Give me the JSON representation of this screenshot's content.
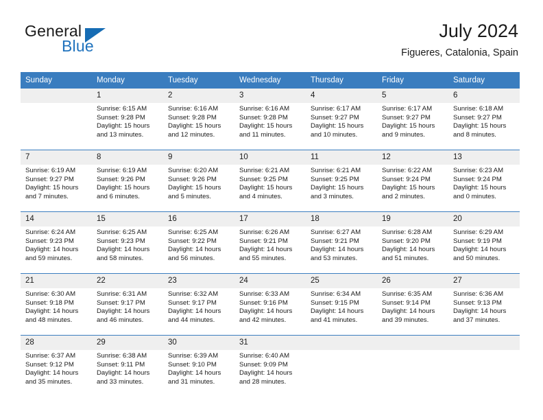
{
  "brand": {
    "name_top": "General",
    "name_bottom": "Blue"
  },
  "header": {
    "title": "July 2024",
    "subtitle": "Figueres, Catalonia, Spain"
  },
  "calendar": {
    "weekday_headers": [
      "Sunday",
      "Monday",
      "Tuesday",
      "Wednesday",
      "Thursday",
      "Friday",
      "Saturday"
    ],
    "accent_color": "#3a7dbf",
    "daynum_background": "#efefef",
    "weeks": [
      [
        {
          "day": "",
          "lines": []
        },
        {
          "day": "1",
          "lines": [
            "Sunrise: 6:15 AM",
            "Sunset: 9:28 PM",
            "Daylight: 15 hours",
            "and 13 minutes."
          ]
        },
        {
          "day": "2",
          "lines": [
            "Sunrise: 6:16 AM",
            "Sunset: 9:28 PM",
            "Daylight: 15 hours",
            "and 12 minutes."
          ]
        },
        {
          "day": "3",
          "lines": [
            "Sunrise: 6:16 AM",
            "Sunset: 9:28 PM",
            "Daylight: 15 hours",
            "and 11 minutes."
          ]
        },
        {
          "day": "4",
          "lines": [
            "Sunrise: 6:17 AM",
            "Sunset: 9:27 PM",
            "Daylight: 15 hours",
            "and 10 minutes."
          ]
        },
        {
          "day": "5",
          "lines": [
            "Sunrise: 6:17 AM",
            "Sunset: 9:27 PM",
            "Daylight: 15 hours",
            "and 9 minutes."
          ]
        },
        {
          "day": "6",
          "lines": [
            "Sunrise: 6:18 AM",
            "Sunset: 9:27 PM",
            "Daylight: 15 hours",
            "and 8 minutes."
          ]
        }
      ],
      [
        {
          "day": "7",
          "lines": [
            "Sunrise: 6:19 AM",
            "Sunset: 9:27 PM",
            "Daylight: 15 hours",
            "and 7 minutes."
          ]
        },
        {
          "day": "8",
          "lines": [
            "Sunrise: 6:19 AM",
            "Sunset: 9:26 PM",
            "Daylight: 15 hours",
            "and 6 minutes."
          ]
        },
        {
          "day": "9",
          "lines": [
            "Sunrise: 6:20 AM",
            "Sunset: 9:26 PM",
            "Daylight: 15 hours",
            "and 5 minutes."
          ]
        },
        {
          "day": "10",
          "lines": [
            "Sunrise: 6:21 AM",
            "Sunset: 9:25 PM",
            "Daylight: 15 hours",
            "and 4 minutes."
          ]
        },
        {
          "day": "11",
          "lines": [
            "Sunrise: 6:21 AM",
            "Sunset: 9:25 PM",
            "Daylight: 15 hours",
            "and 3 minutes."
          ]
        },
        {
          "day": "12",
          "lines": [
            "Sunrise: 6:22 AM",
            "Sunset: 9:24 PM",
            "Daylight: 15 hours",
            "and 2 minutes."
          ]
        },
        {
          "day": "13",
          "lines": [
            "Sunrise: 6:23 AM",
            "Sunset: 9:24 PM",
            "Daylight: 15 hours",
            "and 0 minutes."
          ]
        }
      ],
      [
        {
          "day": "14",
          "lines": [
            "Sunrise: 6:24 AM",
            "Sunset: 9:23 PM",
            "Daylight: 14 hours",
            "and 59 minutes."
          ]
        },
        {
          "day": "15",
          "lines": [
            "Sunrise: 6:25 AM",
            "Sunset: 9:23 PM",
            "Daylight: 14 hours",
            "and 58 minutes."
          ]
        },
        {
          "day": "16",
          "lines": [
            "Sunrise: 6:25 AM",
            "Sunset: 9:22 PM",
            "Daylight: 14 hours",
            "and 56 minutes."
          ]
        },
        {
          "day": "17",
          "lines": [
            "Sunrise: 6:26 AM",
            "Sunset: 9:21 PM",
            "Daylight: 14 hours",
            "and 55 minutes."
          ]
        },
        {
          "day": "18",
          "lines": [
            "Sunrise: 6:27 AM",
            "Sunset: 9:21 PM",
            "Daylight: 14 hours",
            "and 53 minutes."
          ]
        },
        {
          "day": "19",
          "lines": [
            "Sunrise: 6:28 AM",
            "Sunset: 9:20 PM",
            "Daylight: 14 hours",
            "and 51 minutes."
          ]
        },
        {
          "day": "20",
          "lines": [
            "Sunrise: 6:29 AM",
            "Sunset: 9:19 PM",
            "Daylight: 14 hours",
            "and 50 minutes."
          ]
        }
      ],
      [
        {
          "day": "21",
          "lines": [
            "Sunrise: 6:30 AM",
            "Sunset: 9:18 PM",
            "Daylight: 14 hours",
            "and 48 minutes."
          ]
        },
        {
          "day": "22",
          "lines": [
            "Sunrise: 6:31 AM",
            "Sunset: 9:17 PM",
            "Daylight: 14 hours",
            "and 46 minutes."
          ]
        },
        {
          "day": "23",
          "lines": [
            "Sunrise: 6:32 AM",
            "Sunset: 9:17 PM",
            "Daylight: 14 hours",
            "and 44 minutes."
          ]
        },
        {
          "day": "24",
          "lines": [
            "Sunrise: 6:33 AM",
            "Sunset: 9:16 PM",
            "Daylight: 14 hours",
            "and 42 minutes."
          ]
        },
        {
          "day": "25",
          "lines": [
            "Sunrise: 6:34 AM",
            "Sunset: 9:15 PM",
            "Daylight: 14 hours",
            "and 41 minutes."
          ]
        },
        {
          "day": "26",
          "lines": [
            "Sunrise: 6:35 AM",
            "Sunset: 9:14 PM",
            "Daylight: 14 hours",
            "and 39 minutes."
          ]
        },
        {
          "day": "27",
          "lines": [
            "Sunrise: 6:36 AM",
            "Sunset: 9:13 PM",
            "Daylight: 14 hours",
            "and 37 minutes."
          ]
        }
      ],
      [
        {
          "day": "28",
          "lines": [
            "Sunrise: 6:37 AM",
            "Sunset: 9:12 PM",
            "Daylight: 14 hours",
            "and 35 minutes."
          ]
        },
        {
          "day": "29",
          "lines": [
            "Sunrise: 6:38 AM",
            "Sunset: 9:11 PM",
            "Daylight: 14 hours",
            "and 33 minutes."
          ]
        },
        {
          "day": "30",
          "lines": [
            "Sunrise: 6:39 AM",
            "Sunset: 9:10 PM",
            "Daylight: 14 hours",
            "and 31 minutes."
          ]
        },
        {
          "day": "31",
          "lines": [
            "Sunrise: 6:40 AM",
            "Sunset: 9:09 PM",
            "Daylight: 14 hours",
            "and 28 minutes."
          ]
        },
        {
          "day": "",
          "lines": []
        },
        {
          "day": "",
          "lines": []
        },
        {
          "day": "",
          "lines": []
        }
      ]
    ]
  }
}
